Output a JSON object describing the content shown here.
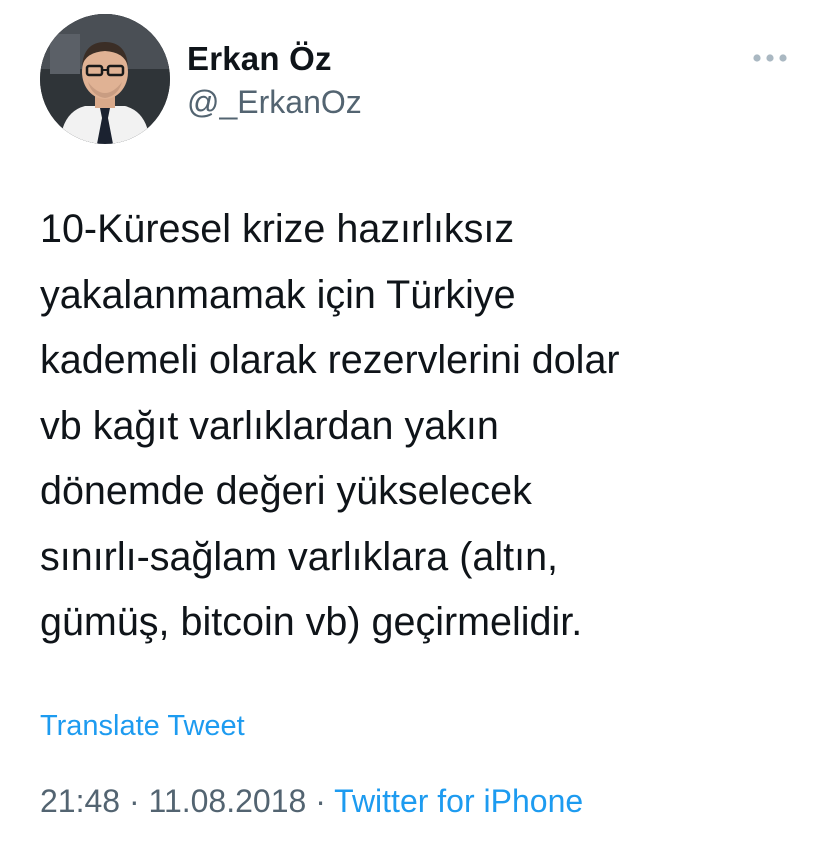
{
  "author": {
    "name": "Erkan Öz",
    "handle": "@_ErkanOz"
  },
  "tweet": {
    "text": "10-Küresel krize hazırlıksız\nyakalanmamak için Türkiye\nkademeli olarak rezervlerini dolar\nvb kağıt varlıklardan yakın\ndönemde değeri yükselecek\nsınırlı-sağlam varlıklara (altın,\ngümüş, bitcoin vb) geçirmelidir.",
    "translate_label": "Translate Tweet",
    "time": "21:48",
    "date": "11.08.2018",
    "separator": "·",
    "source": "Twitter for iPhone"
  },
  "icons": {
    "more": "more-horizontal-icon",
    "avatar": "avatar"
  },
  "colors": {
    "text": "#0f1419",
    "secondary": "#536471",
    "link": "#1d9bf0",
    "background": "#ffffff"
  }
}
